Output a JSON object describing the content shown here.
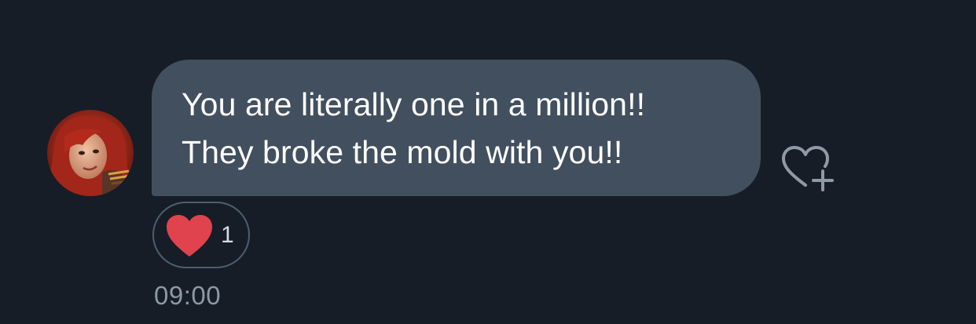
{
  "message": {
    "lines": [
      "You are literally one in a million!!",
      "They broke the mold with you!!"
    ]
  },
  "reaction": {
    "emoji": "heart-icon",
    "count": "1"
  },
  "add_reaction_icon": "heart-plus-icon",
  "timestamp": "09:00",
  "colors": {
    "background": "#161d27",
    "bubble": "#424f5e",
    "text": "#ffffff",
    "heart": "#e0434e",
    "pill_border": "#4e5e6f",
    "timestamp": "#8d99a6"
  }
}
